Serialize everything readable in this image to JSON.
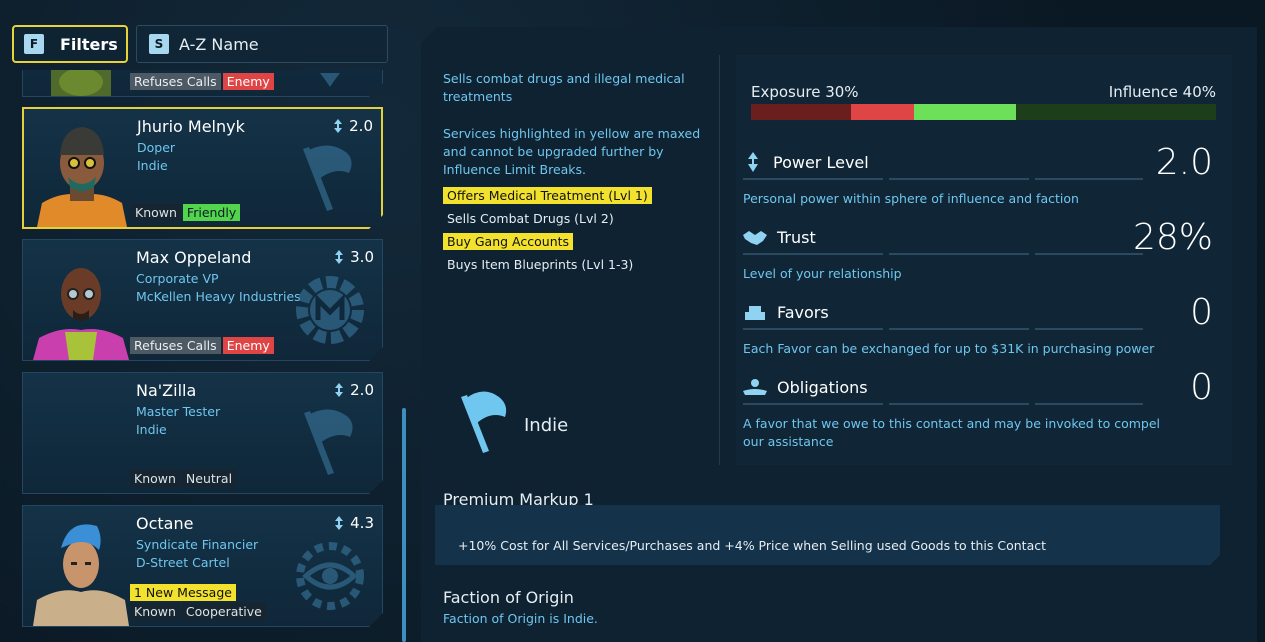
{
  "filters": {
    "key": "F",
    "label": "Filters"
  },
  "sort": {
    "key": "S",
    "label": "A-Z Name"
  },
  "contacts": [
    {
      "name": "",
      "role": "",
      "faction": "",
      "power": "",
      "badges": [
        "Refuses Calls",
        "Enemy"
      ]
    },
    {
      "name": "Jhurio Melnyk",
      "role": "Doper",
      "faction": "Indie",
      "power": "2.0",
      "badges": [
        "Known",
        "Friendly"
      ],
      "selected": true
    },
    {
      "name": "Max Oppeland",
      "role": "Corporate VP",
      "faction": "McKellen Heavy Industries",
      "power": "3.0",
      "badges": [
        "Refuses Calls",
        "Enemy"
      ]
    },
    {
      "name": "Na'Zilla",
      "role": "Master Tester",
      "faction": "Indie",
      "power": "2.0",
      "badges": [
        "Known",
        "Neutral"
      ]
    },
    {
      "name": "Octane",
      "role": "Syndicate Financier",
      "faction": "D-Street Cartel",
      "power": "4.3",
      "message": "1 New Message",
      "badges": [
        "Known",
        "Cooperative"
      ]
    }
  ],
  "detail": {
    "description": "Sells combat drugs and illegal medical treatments",
    "note": "Services highlighted in yellow are maxed and cannot be upgraded further by Influence Limit Breaks.",
    "services": [
      {
        "label": "Offers Medical Treatment (Lvl 1)",
        "maxed": true
      },
      {
        "label": "Sells Combat Drugs (Lvl 2)",
        "maxed": false
      },
      {
        "label": "Buy Gang Accounts",
        "maxed": true
      },
      {
        "label": "Buys Item Blueprints (Lvl 1-3)",
        "maxed": false
      }
    ],
    "faction_name": "Indie",
    "exposure_label": "Exposure 30%",
    "influence_label": "Influence 40%",
    "exposure_pct": 30,
    "influence_pct": 40,
    "stats": {
      "power": {
        "label": "Power Level",
        "value": "2.0",
        "sub": "Personal power within sphere of influence and faction"
      },
      "trust": {
        "label": "Trust",
        "value": "28%",
        "sub": "Level of your relationship"
      },
      "favors": {
        "label": "Favors",
        "value": "0",
        "sub": "Each Favor can be exchanged for up to $31K in purchasing power"
      },
      "obligations": {
        "label": "Obligations",
        "value": "0",
        "sub": "A favor that we owe to this contact and may be invoked to compel our assistance"
      }
    },
    "markup_title": "Premium Markup 1",
    "markup_text": "+10% Cost for All Services/Purchases and +4% Price when Selling used Goods to this Contact",
    "origin_title": "Faction of Origin",
    "origin_text": "Faction of Origin is Indie."
  },
  "colors": {
    "accent_yellow": "#f2e22e",
    "enemy_red": "#e04546",
    "friendly_green": "#52d54c",
    "text_blue": "#6fc6ee"
  }
}
